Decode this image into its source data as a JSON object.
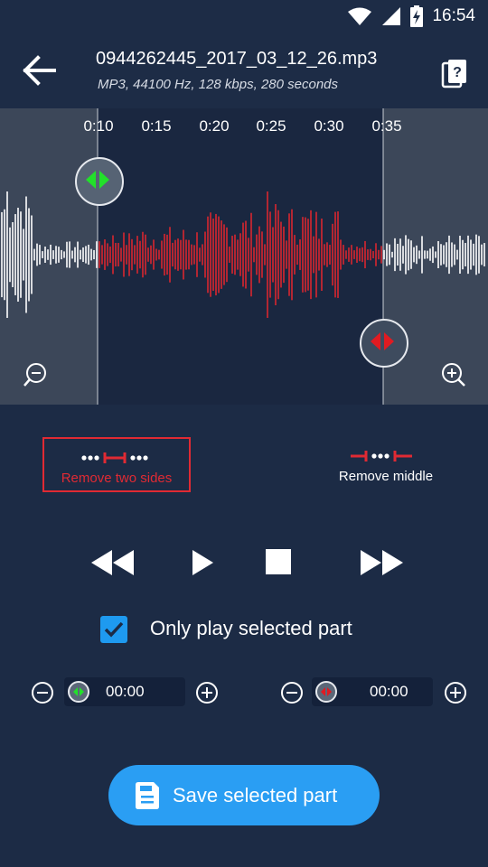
{
  "status": {
    "time": "16:54",
    "icons": [
      "wifi-icon",
      "cell-signal-icon",
      "battery-charging-icon"
    ]
  },
  "toolbar": {
    "title": "0944262445_2017_03_12_26.mp3",
    "subtitle": "MP3, 44100 Hz, 128 kbps, 280 seconds",
    "back_icon": "arrow-left-icon",
    "help_icon": "help-document-icon"
  },
  "timeline": {
    "ticks": [
      "0:10",
      "0:15",
      "0:20",
      "0:25",
      "0:30",
      "0:35"
    ]
  },
  "colors": {
    "accent": "#2a9ef3",
    "selected_wave": "#d8262f",
    "start_handle": "#22e02a",
    "end_handle": "#e01b22"
  },
  "modes": {
    "remove_two_sides": "Remove two sides",
    "remove_middle": "Remove middle"
  },
  "player": {
    "icons": [
      "rewind-icon",
      "play-icon",
      "stop-icon",
      "fast-forward-icon"
    ]
  },
  "options": {
    "only_play_selected": "Only play selected part",
    "only_play_selected_checked": true
  },
  "start_time": {
    "value": "00:00"
  },
  "end_time": {
    "value": "00:00"
  },
  "save": {
    "label": "Save selected part"
  }
}
